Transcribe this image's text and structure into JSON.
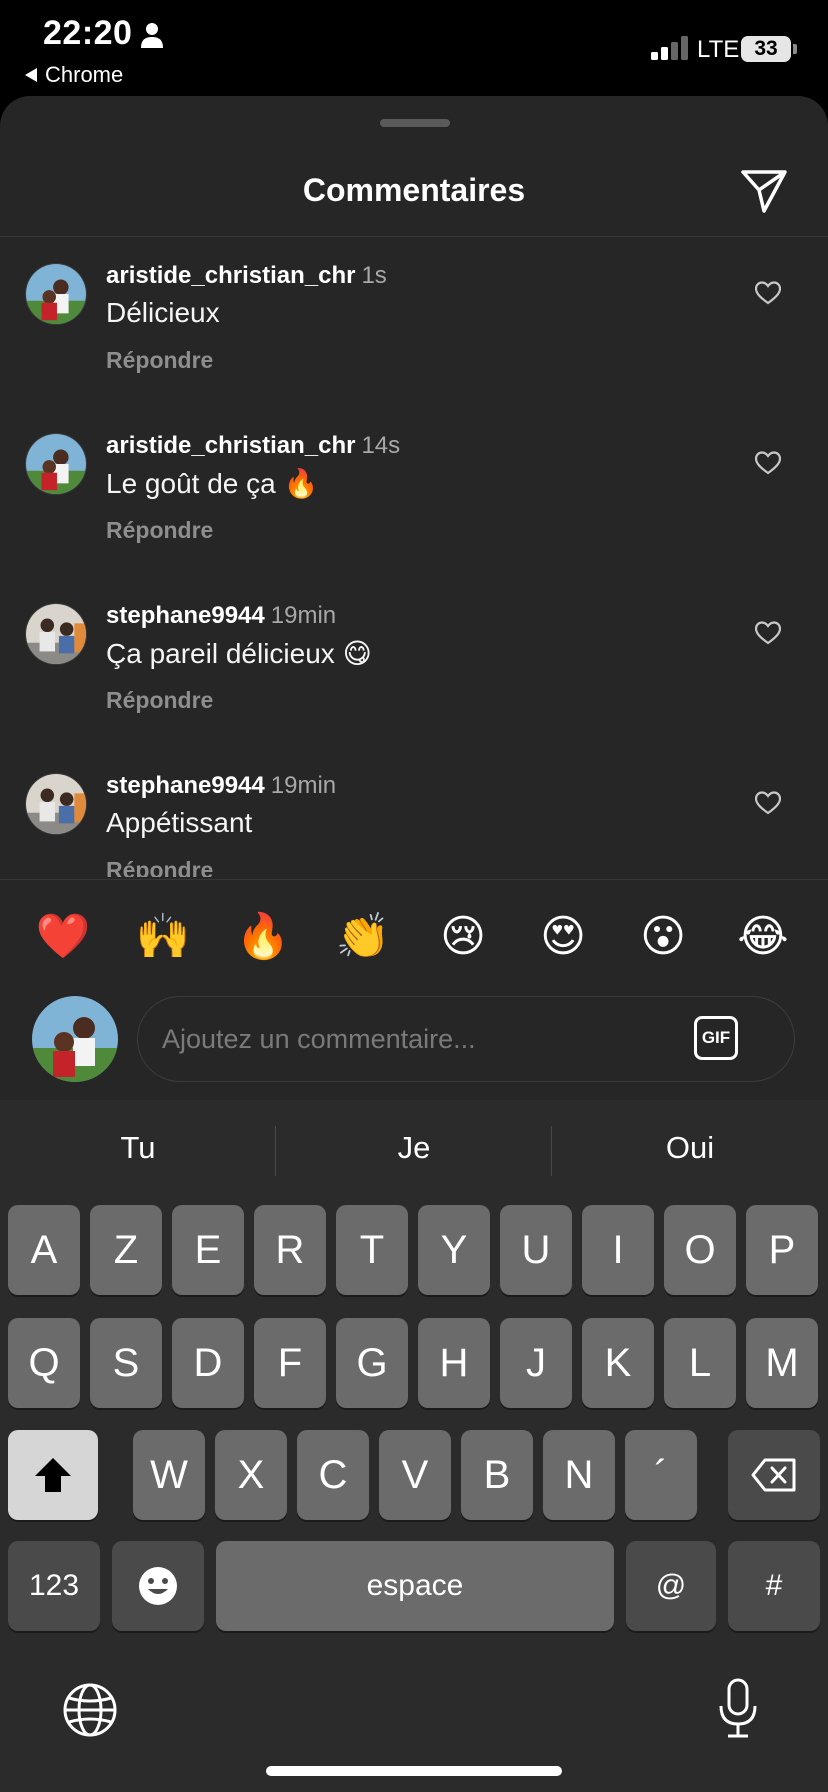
{
  "status_bar": {
    "time": "22:20",
    "back_app": "Chrome",
    "network": "LTE",
    "battery": "33"
  },
  "sheet": {
    "title": "Commentaires"
  },
  "comments": [
    {
      "user": "aristide_christian_chr",
      "time": "1s",
      "text": "Délicieux",
      "reply": "Répondre"
    },
    {
      "user": "aristide_christian_chr",
      "time": "14s",
      "text": "Le goût de ça 🔥",
      "reply": "Répondre"
    },
    {
      "user": "stephane9944",
      "time": "19min",
      "text": "Ça pareil délicieux 😋",
      "reply": "Répondre"
    },
    {
      "user": "stephane9944",
      "time": "19min",
      "text": "Appétissant",
      "reply": "Répondre"
    }
  ],
  "reactions": [
    "❤️",
    "🙌",
    "🔥",
    "👏",
    "😢",
    "😍",
    "😮",
    "😂"
  ],
  "composer": {
    "placeholder": "Ajoutez un commentaire...",
    "gif_label": "GIF"
  },
  "keyboard": {
    "suggestions": [
      "Tu",
      "Je",
      "Oui"
    ],
    "row1": [
      "A",
      "Z",
      "E",
      "R",
      "T",
      "Y",
      "U",
      "I",
      "O",
      "P"
    ],
    "row2": [
      "Q",
      "S",
      "D",
      "F",
      "G",
      "H",
      "J",
      "K",
      "L",
      "M"
    ],
    "row3": [
      "W",
      "X",
      "C",
      "V",
      "B",
      "N",
      "´"
    ],
    "numbers_label": "123",
    "space_label": "espace",
    "at_label": "@",
    "hash_label": "#"
  }
}
